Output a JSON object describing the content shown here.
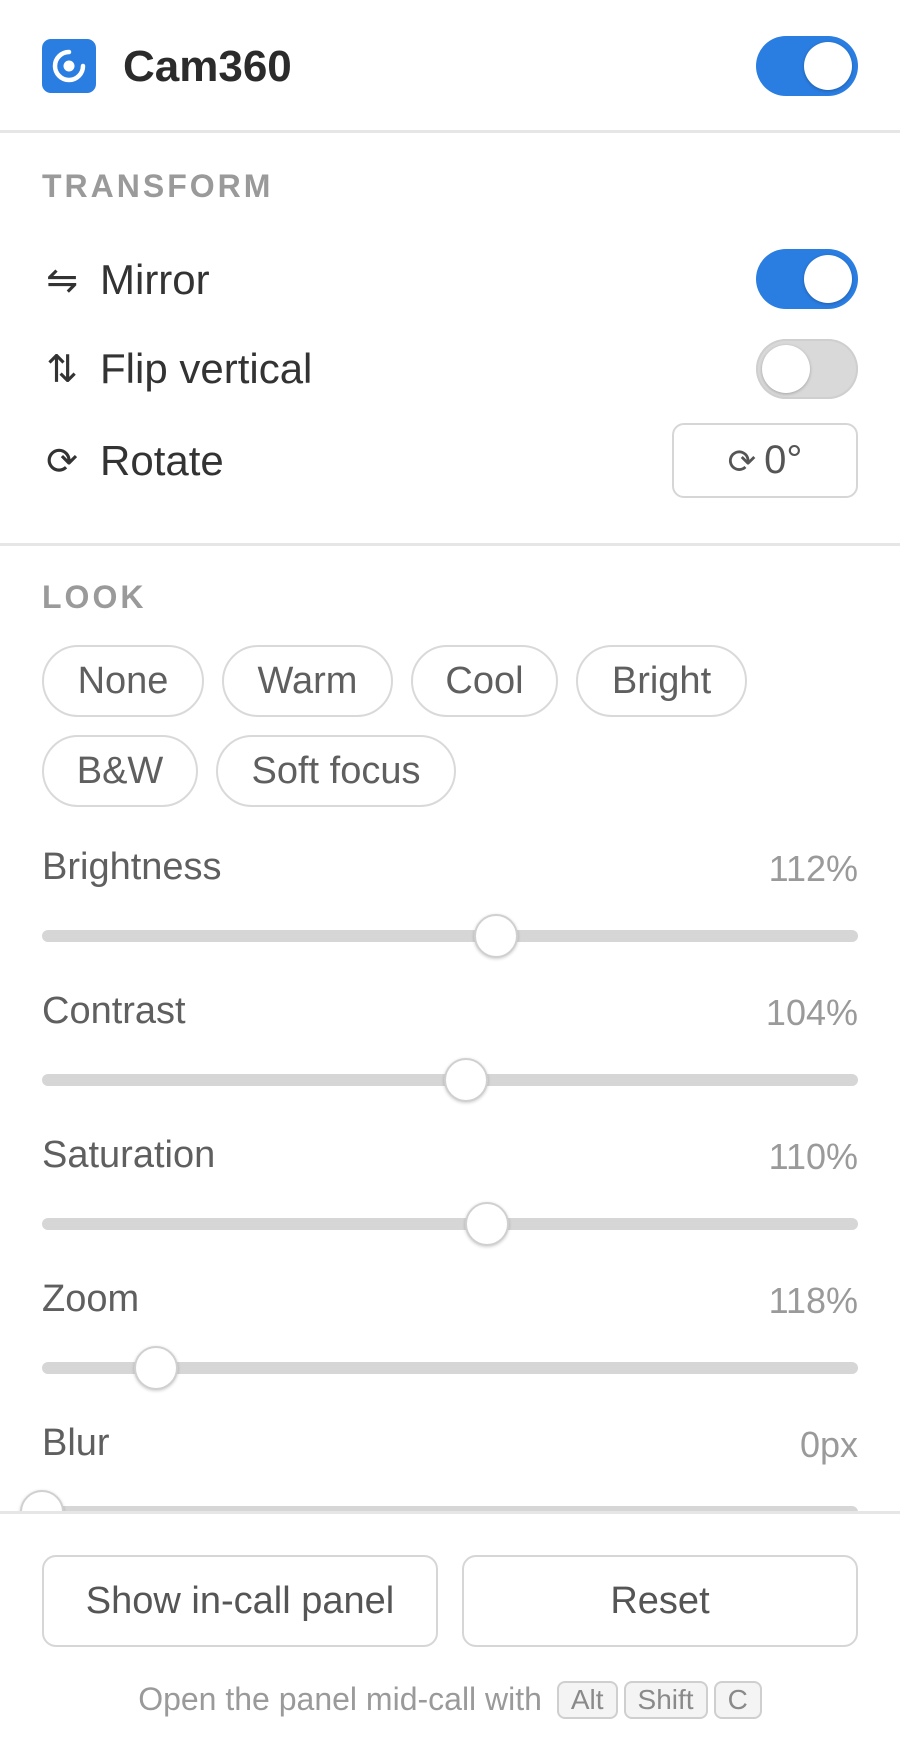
{
  "header": {
    "title": "Cam360",
    "logo_icon": "camera-lens-icon",
    "master_toggle": {
      "on": true
    }
  },
  "colors": {
    "accent": "#2a7de1",
    "toggle_off": "#d9d9d9",
    "track": "#d6d6d6"
  },
  "transform": {
    "title": "TRANSFORM",
    "mirror": {
      "icon": "⇋",
      "icon_name": "mirror-arrows-icon",
      "label": "Mirror",
      "on": true
    },
    "flip": {
      "icon": "⇅",
      "icon_name": "flip-vertical-arrows-icon",
      "label": "Flip vertical",
      "on": false
    },
    "rotate": {
      "icon": "⟳",
      "icon_name": "rotate-clockwise-icon",
      "label": "Rotate",
      "button_icon": "⟳",
      "value": "0°"
    }
  },
  "look": {
    "title": "LOOK",
    "presets": [
      "None",
      "Warm",
      "Cool",
      "Bright",
      "B&W",
      "Soft focus"
    ]
  },
  "sliders": [
    {
      "label": "Brightness",
      "value": "112%",
      "fraction": 0.556
    },
    {
      "label": "Contrast",
      "value": "104%",
      "fraction": 0.52
    },
    {
      "label": "Saturation",
      "value": "110%",
      "fraction": 0.545
    },
    {
      "label": "Zoom",
      "value": "118%",
      "fraction": 0.14
    },
    {
      "label": "Blur",
      "value": "0px",
      "fraction": 0.0
    }
  ],
  "footer": {
    "show_panel_label": "Show in-call panel",
    "reset_label": "Reset",
    "hint_text": "Open the panel mid-call with",
    "keys": [
      "Alt",
      "Shift",
      "C"
    ]
  }
}
